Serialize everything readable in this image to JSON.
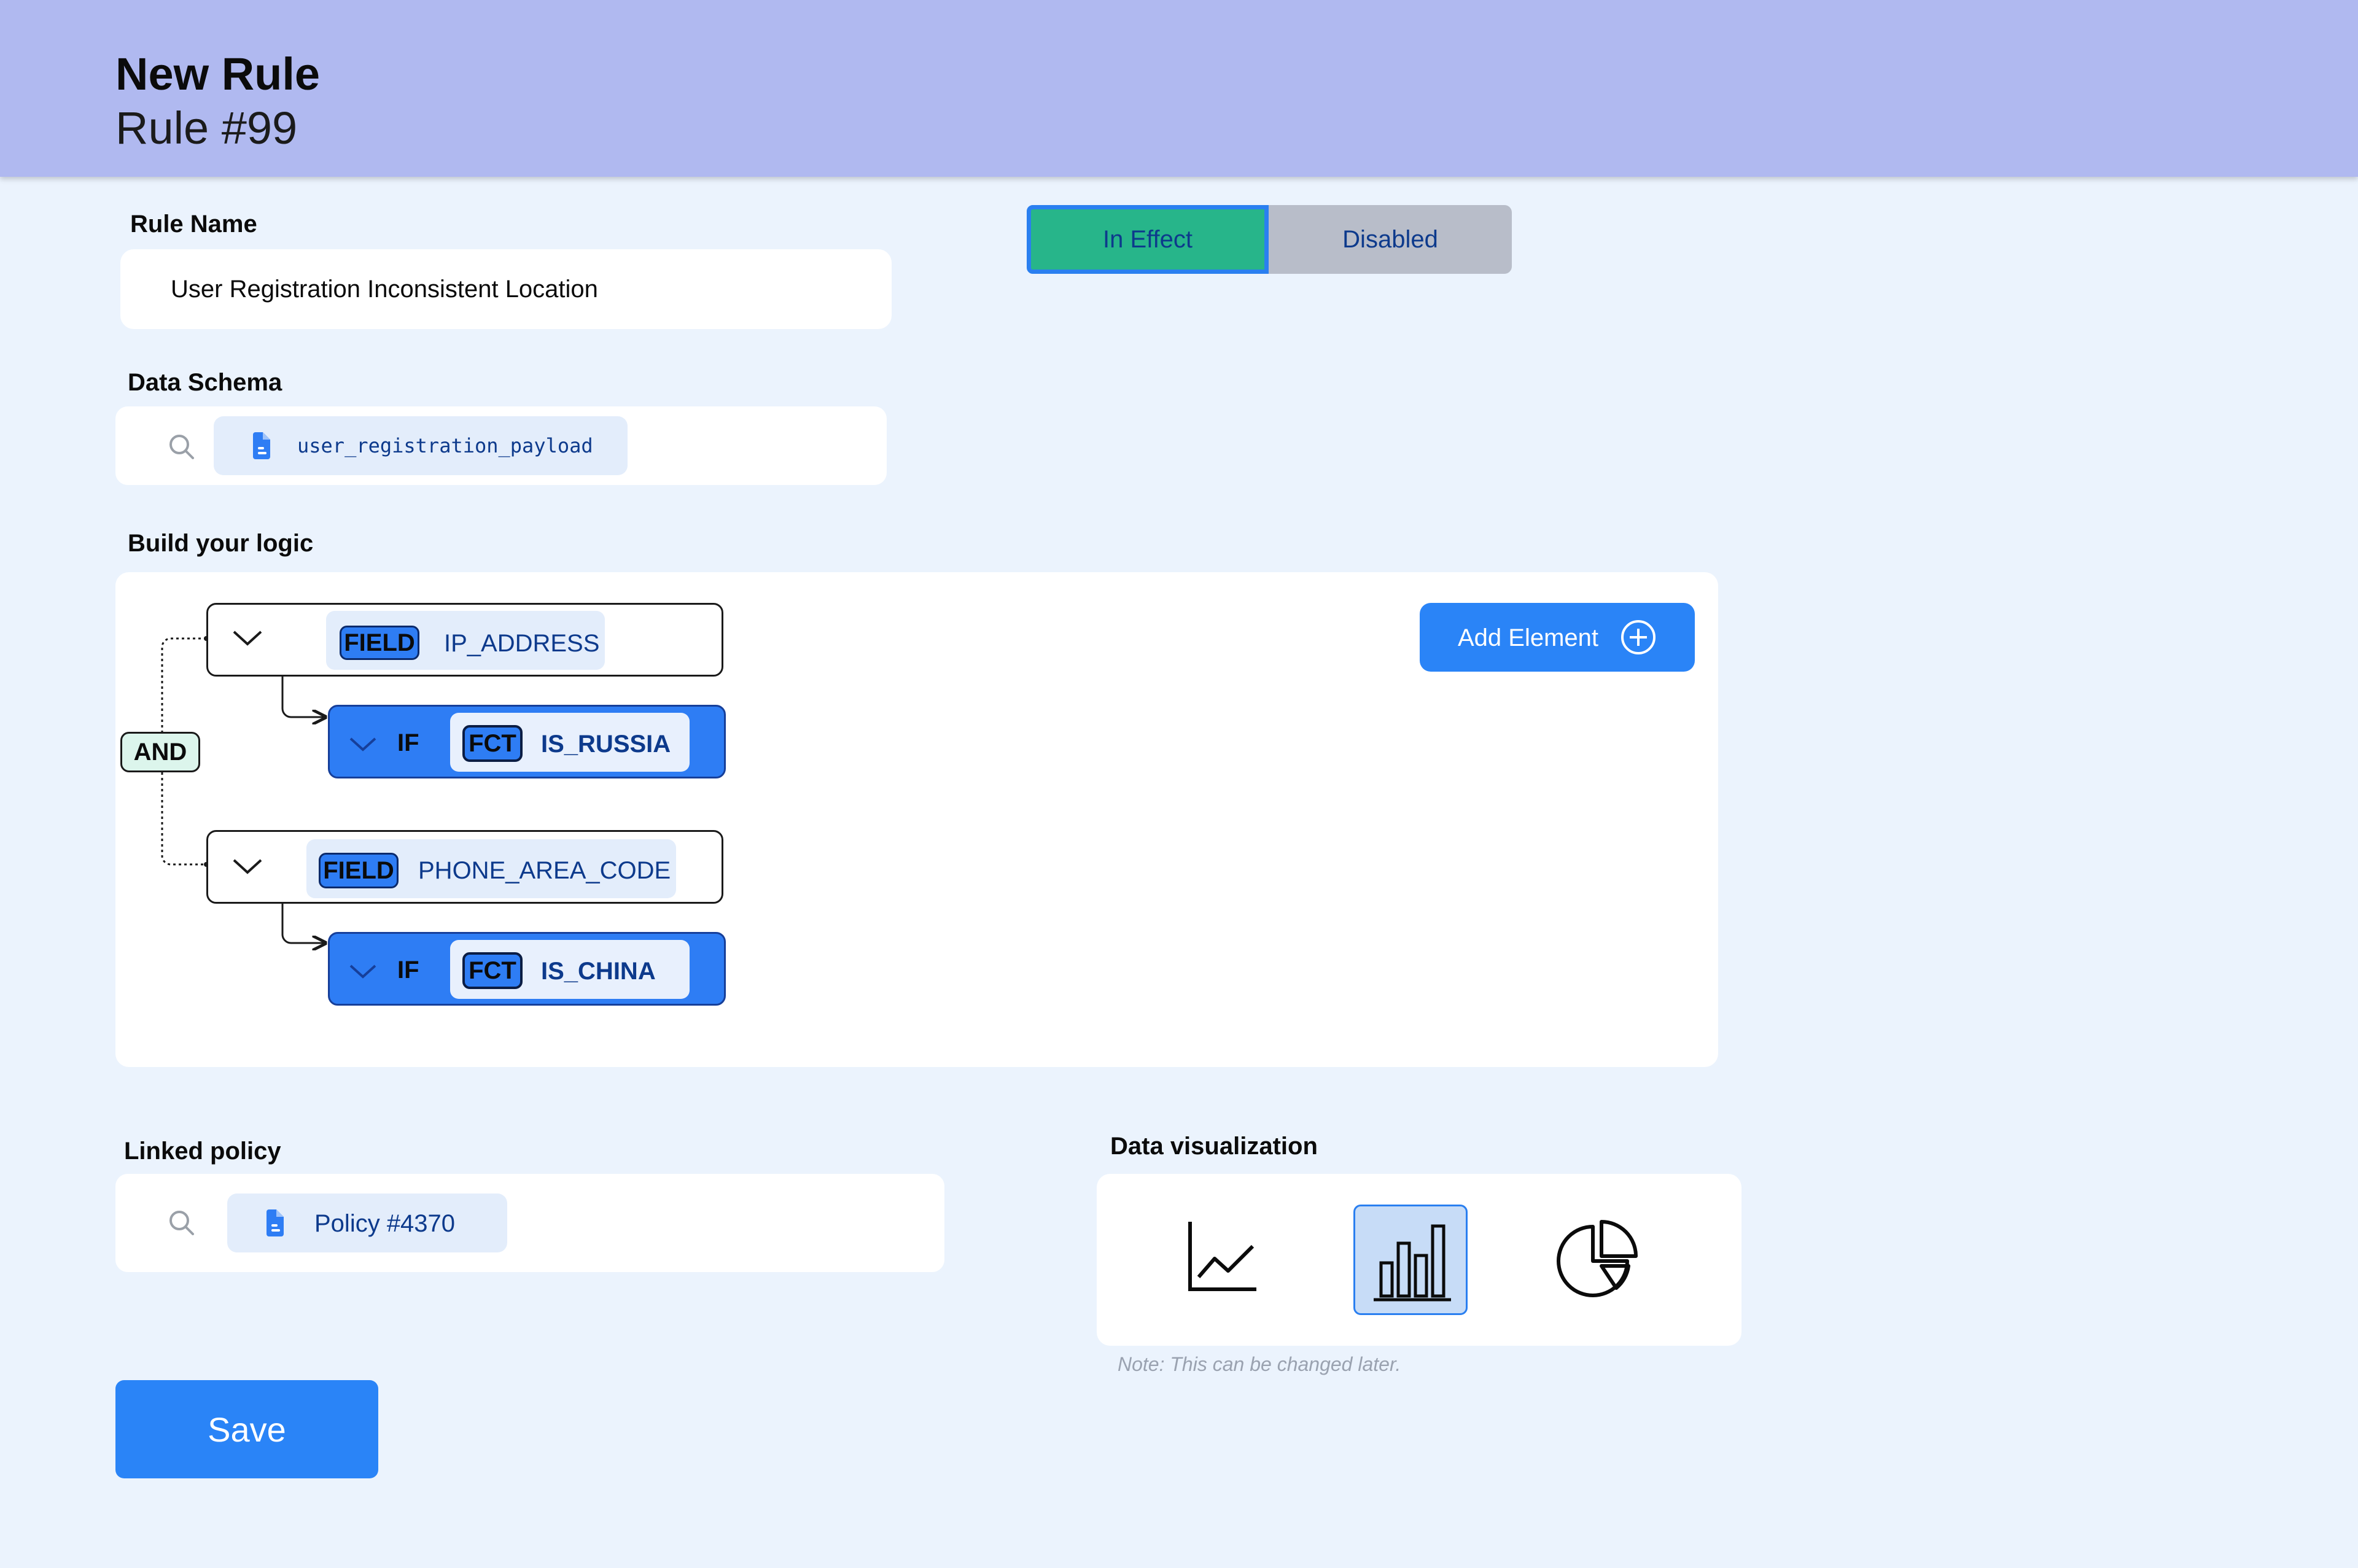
{
  "header": {
    "title": "New Rule",
    "subtitle": "Rule #99"
  },
  "rule_name": {
    "label": "Rule Name",
    "value": "User Registration Inconsistent Location"
  },
  "status_toggle": {
    "on_label": "In Effect",
    "off_label": "Disabled",
    "selected": "In Effect"
  },
  "data_schema": {
    "label": "Data Schema",
    "chip": "user_registration_payload"
  },
  "logic": {
    "label": "Build your logic",
    "operator": "AND",
    "add_button": "Add Element",
    "groups": [
      {
        "field_tag": "FIELD",
        "field": "IP_ADDRESS",
        "if_label": "IF",
        "fct_tag": "FCT",
        "function": "IS_RUSSIA"
      },
      {
        "field_tag": "FIELD",
        "field": "PHONE_AREA_CODE",
        "if_label": "IF",
        "fct_tag": "FCT",
        "function": "IS_CHINA"
      }
    ]
  },
  "linked_policy": {
    "label": "Linked policy",
    "chip": "Policy #4370"
  },
  "data_visualization": {
    "label": "Data visualization",
    "options": [
      "line-chart-icon",
      "bar-chart-icon",
      "pie-chart-icon"
    ],
    "selected": "bar-chart-icon",
    "note": "Note: This can be changed later."
  },
  "save_button": "Save",
  "colors": {
    "header_bg": "#b0b9f0",
    "page_bg": "#ebf3fd",
    "accent_blue": "#2a84f7",
    "active_green": "#27b58a",
    "disabled_gray": "#b8bdc9"
  }
}
